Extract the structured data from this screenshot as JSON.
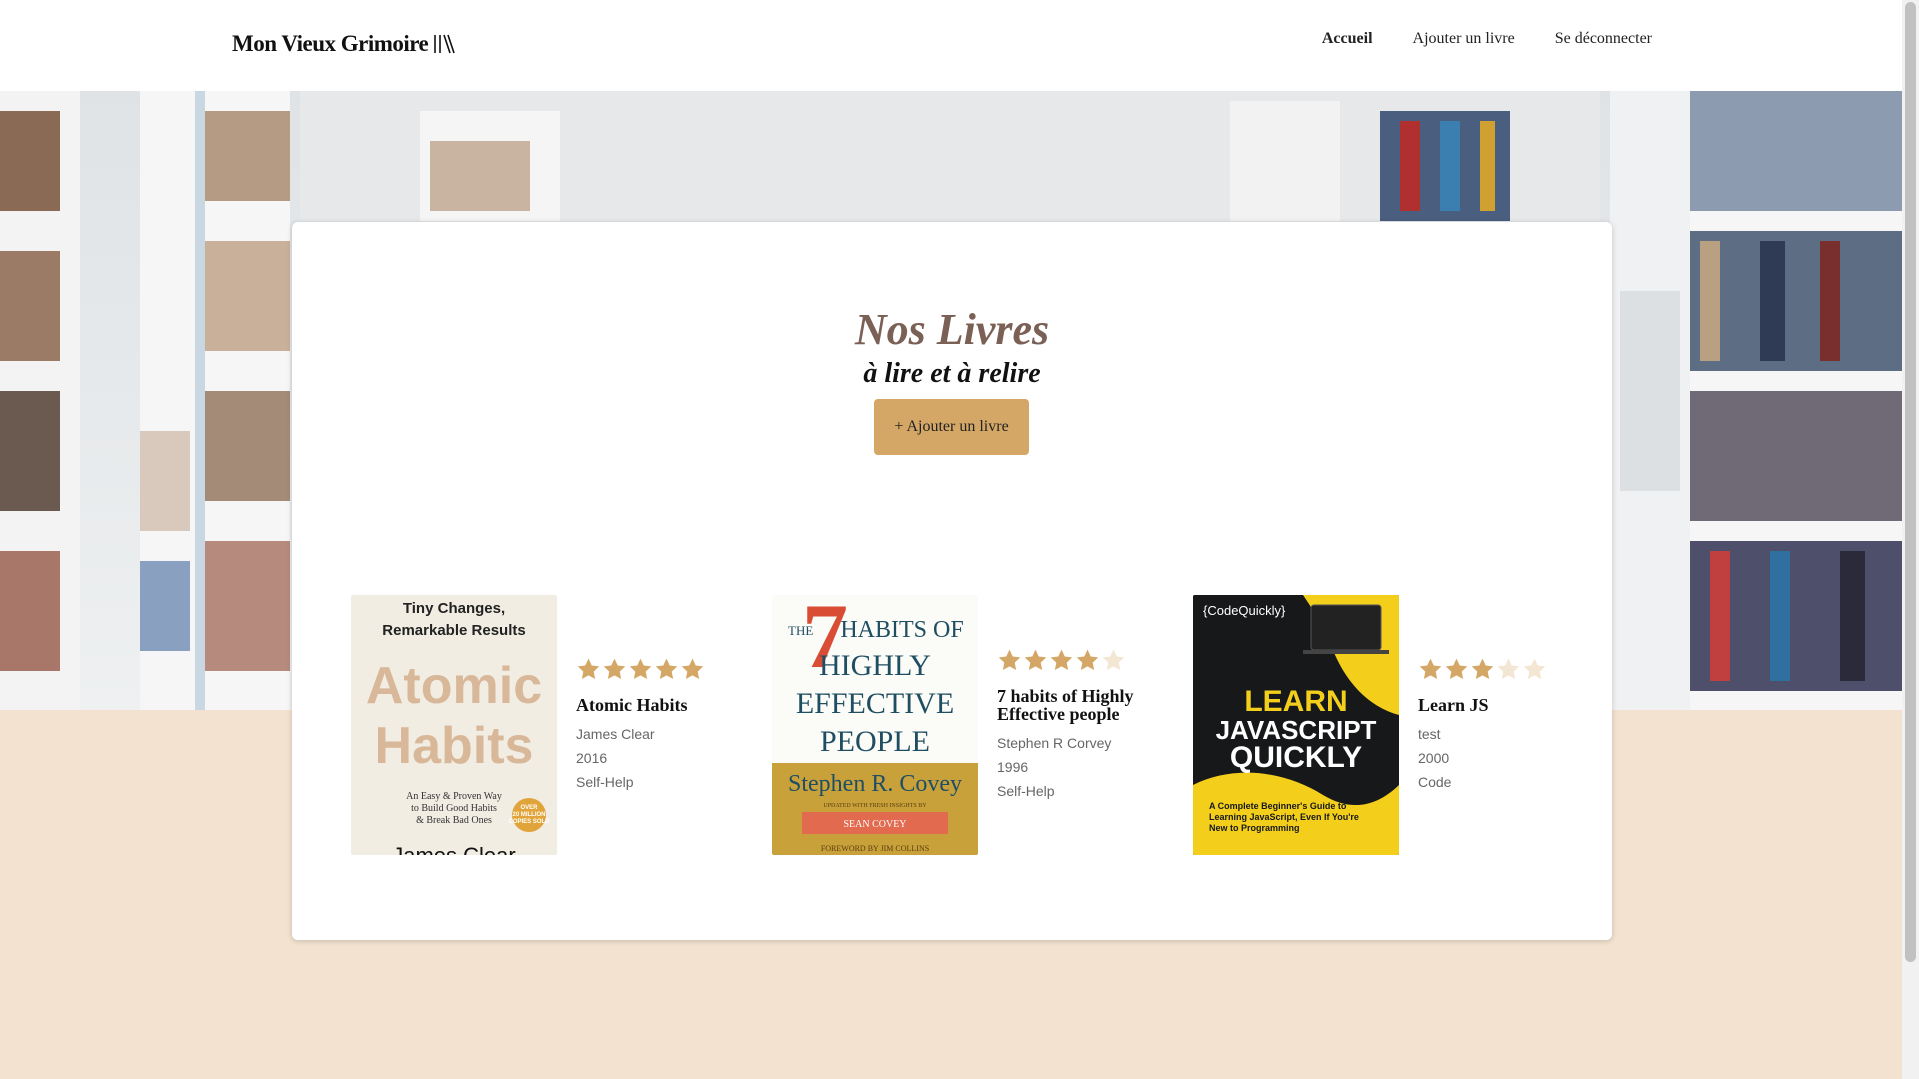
{
  "header": {
    "logo_text": "Mon Vieux Grimoire",
    "nav": [
      {
        "label": "Accueil",
        "active": true
      },
      {
        "label": "Ajouter un livre",
        "active": false
      },
      {
        "label": "Se déconnecter",
        "active": false
      }
    ]
  },
  "main": {
    "title": "Nos Livres",
    "subtitle": "à lire et à relire",
    "add_button": "+ Ajouter un livre"
  },
  "books": [
    {
      "title": "Atomic Habits",
      "author": "James Clear",
      "year": "2016",
      "genre": "Self-Help",
      "rating": 5,
      "cover": {
        "top_text": "Tiny Changes,\nRemarkable Results",
        "big_text_1": "Atomic",
        "big_text_2": "Habits",
        "small_text": "An Easy & Proven Way\nto Build Good Habits\n& Break Bad Ones",
        "badge": "OVER 20 MILLION COPIES SOLD",
        "bottom_text": "James Clear"
      }
    },
    {
      "title": "7 habits of Highly Effective people",
      "author": "Stephen R Corvey",
      "year": "1996",
      "genre": "Self-Help",
      "rating": 4,
      "cover": {
        "number": "7",
        "the": "THE",
        "line1": "HABITS OF",
        "line2": "HIGHLY",
        "line3": "EFFECTIVE",
        "line4": "PEOPLE",
        "author": "Stephen R. Covey",
        "insights": "UPDATED WITH FRESH INSIGHTS BY",
        "sean": "SEAN COVEY",
        "foreword": "FOREWORD BY JIM COLLINS"
      }
    },
    {
      "title": "Learn JS",
      "author": "test",
      "year": "2000",
      "genre": "Code",
      "rating": 3,
      "cover": {
        "brand": "{CodeQuickly}",
        "line1": "LEARN",
        "line2": "JAVASCRIPT",
        "line3": "QUICKLY",
        "small_text": "A Complete Beginner's Guide to Learning JavaScript, Even If You're New to Programming"
      }
    }
  ],
  "colors": {
    "accent": "#d4a766",
    "star_filled": "#d4a766",
    "star_empty": "#f3e6d2",
    "title": "#7a6055",
    "page_bg": "#f2e2cf"
  }
}
